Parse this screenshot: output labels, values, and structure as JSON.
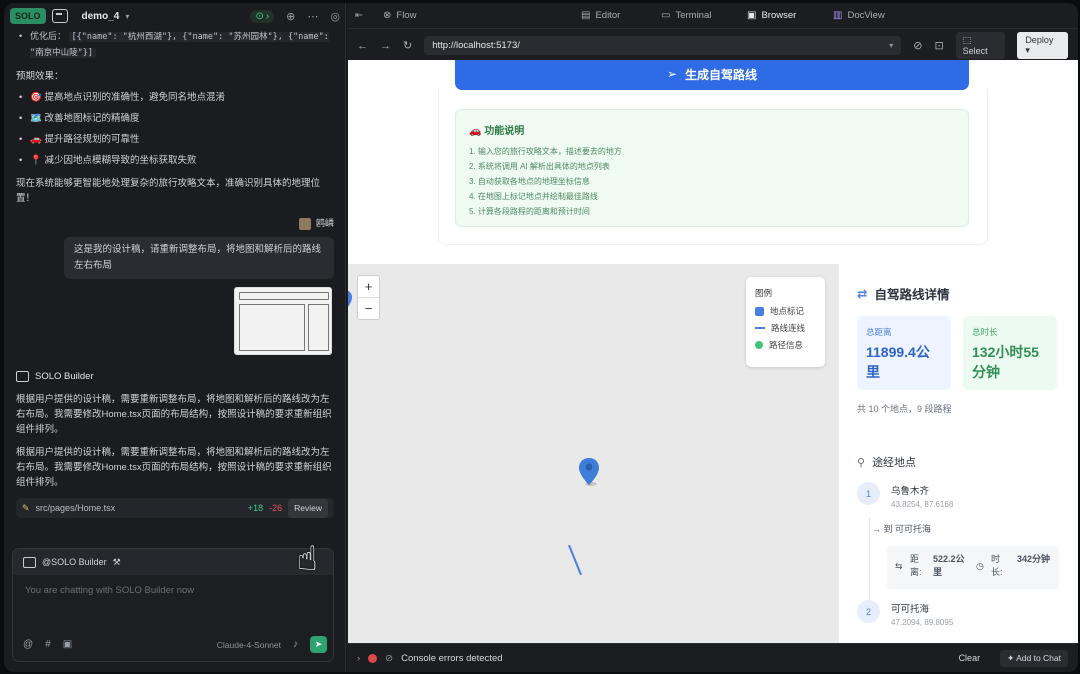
{
  "topbar": {
    "badge": "SOLO",
    "project": "demo_4"
  },
  "chat": {
    "code_label": "优化后：",
    "code_snippet": "[{\"name\": \"杭州西湖\"}, {\"name\": \"苏州园林\"}, {\"name\": \"南京中山陵\"}]",
    "effects_title": "预期效果：",
    "bullets": [
      "🎯 提高地点识别的准确性，避免同名地点混淆",
      "🗺️ 改善地图标记的精确度",
      "🚗 提升路径规划的可靠性",
      "📍 减少因地点模糊导致的坐标获取失败"
    ],
    "conclusion": "现在系统能够更智能地处理复杂的旅行攻略文本，准确识别具体的地理位置！",
    "user_name": "鸥嶙",
    "user_message": "这是我的设计稿，请重新调整布局，将地图和解析后的路线左右布局",
    "bot_name": "SOLO Builder",
    "bot_reply_1": "根据用户提供的设计稿，需要重新调整布局，将地图和解析后的路线改为左右布局。我需要修改Home.tsx页面的布局结构，按照设计稿的要求重新组织组件排列。",
    "bot_reply_2": "根据用户提供的设计稿，需要重新调整布局，将地图和解析后的路线改为左右布局。我需要修改Home.tsx页面的布局结构，按照设计稿的要求重新组织组件排列。",
    "file_path": "src/pages/Home.tsx",
    "file_added": "+18",
    "file_removed": "-26",
    "review_label": "Review"
  },
  "input": {
    "agent": "@SOLO Builder",
    "placeholder": "You are chatting with SOLO Builder now",
    "model": "Claude-4-Sonnet"
  },
  "browser": {
    "tabs": [
      "Flow",
      "Editor",
      "Terminal",
      "Browser",
      "DocView"
    ],
    "url": "http://localhost:5173/",
    "select_label": "Select",
    "deploy_label": "Deploy"
  },
  "page": {
    "generate_button": "生成自驾路线",
    "info_title": "🚗 功能说明",
    "info_items": [
      "1. 输入您的旅行攻略文本，描述要去的地方",
      "2. 系统将调用 AI 解析出具体的地点列表",
      "3. 自动获取各地点的地理坐标信息",
      "4. 在地图上标记地点并绘制最佳路线",
      "5. 计算各段路程的距离和预计时间"
    ],
    "legend": {
      "title": "图例",
      "items": [
        "地点标记",
        "路线连线",
        "路径信息"
      ]
    },
    "details_title": "自驾路线详情",
    "total_distance_label": "总距离",
    "total_distance_value": "11899.4公里",
    "total_time_label": "总时长",
    "total_time_value": "132小时55分钟",
    "summary": "共 10 个地点，9 段路程",
    "via_title": "途经地点",
    "stops": [
      {
        "num": "1",
        "name": "乌鲁木齐",
        "coord": "43.8254, 87.6168"
      },
      {
        "num": "2",
        "name": "可可托海",
        "coord": "47.2094, 89.8095"
      }
    ],
    "to_label": "到 可可托海",
    "segment": {
      "dist_label": "距离:",
      "dist_value": "522.2公里",
      "time_label": "时长:",
      "time_value": "342分钟"
    }
  },
  "console": {
    "message": "Console errors detected",
    "clear": "Clear",
    "add_to_chat": "Add to Chat"
  },
  "colors": {
    "accent": "#2f6be4",
    "success": "#2ea26f",
    "error": "#e0484a"
  }
}
